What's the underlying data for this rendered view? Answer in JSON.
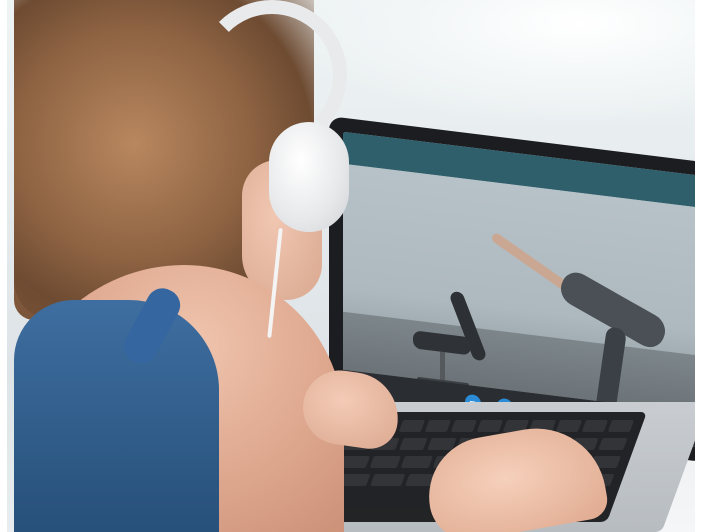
{
  "scene": {
    "description_tags": [
      "woman-with-headphones",
      "laptop",
      "video-call"
    ],
    "colors": {
      "screen_header": "#2e5f6b",
      "tank_top": "#2f5f94",
      "control_blue": "#2b8bd6",
      "control_red": "#e23b3b"
    }
  },
  "video_call": {
    "controls": [
      {
        "icon": "camera-icon",
        "color": "#2b8bd6"
      },
      {
        "icon": "microphone-icon",
        "color": "#2b8bd6"
      },
      {
        "icon": "chat-icon",
        "color": "#2b8bd6"
      },
      {
        "icon": "end-call-icon",
        "color": "#e23b3b"
      }
    ]
  }
}
